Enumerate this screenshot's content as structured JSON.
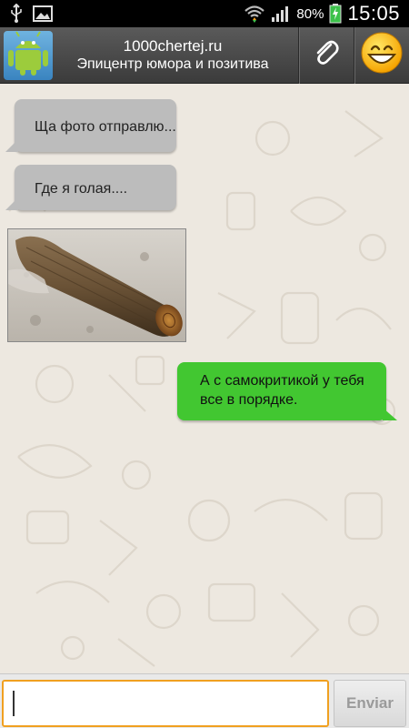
{
  "status_bar": {
    "battery_percent": "80%",
    "time": "15:05",
    "icons": [
      "usb-icon",
      "image-icon",
      "wifi-icon",
      "signal-icon",
      "battery-charging-icon"
    ]
  },
  "header": {
    "title": "1000chertej.ru",
    "subtitle": "Эпицентр юмора и позитива",
    "avatar_icon": "android-icon",
    "attach_icon": "paperclip-icon",
    "emoji_icon": "smiley-icon"
  },
  "messages": [
    {
      "direction": "incoming",
      "type": "text",
      "text": "Ща фото отправлю..."
    },
    {
      "direction": "incoming",
      "type": "text",
      "text": "Где я голая...."
    },
    {
      "direction": "incoming",
      "type": "image",
      "image_icon": "log-in-snow-photo"
    },
    {
      "direction": "outgoing",
      "type": "text",
      "text": "А с самокритикой у тебя все в порядке."
    }
  ],
  "composer": {
    "input_value": "",
    "send_label": "Enviar"
  },
  "colors": {
    "incoming_bubble": "#bcbcbc",
    "outgoing_bubble": "#42c731",
    "chat_background": "#ede8e0",
    "input_focus_border": "#f0a020"
  }
}
